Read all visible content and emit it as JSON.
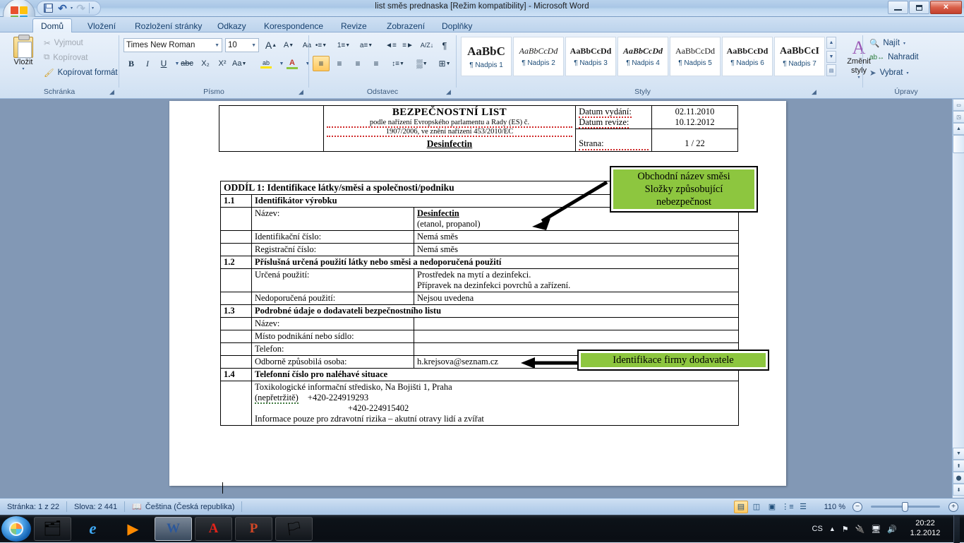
{
  "window": {
    "title": "list směs prednaska [Režim kompatibility] - Microsoft Word",
    "minimize": "minimize-button",
    "restore": "restore-button",
    "close": "✕"
  },
  "quick_access": {
    "save": "save-icon",
    "undo": "↶",
    "undo_dd": "▾",
    "redo": "↷",
    "customize": "▾"
  },
  "office_button": "office-logo",
  "ribbon": {
    "tabs": [
      {
        "label": "Domů",
        "active": true
      },
      {
        "label": "Vložení",
        "active": false
      },
      {
        "label": "Rozložení stránky",
        "active": false
      },
      {
        "label": "Odkazy",
        "active": false
      },
      {
        "label": "Korespondence",
        "active": false
      },
      {
        "label": "Revize",
        "active": false
      },
      {
        "label": "Zobrazení",
        "active": false
      },
      {
        "label": "Doplňky",
        "active": false
      }
    ],
    "clipboard": {
      "group_label": "Schránka",
      "paste": "Vložit",
      "paste_arrow": "▾",
      "cut": "Vyjmout",
      "copy": "Kopírovat",
      "format_painter": "Kopírovat formát"
    },
    "font": {
      "group_label": "Písmo",
      "font_name": "Times New Roman",
      "font_size": "10",
      "grow_font": "A",
      "shrink_font": "A",
      "clear_formatting": "Aa",
      "bold": "B",
      "italic": "I",
      "underline": "U",
      "strikethrough": "abc",
      "subscript": "X₂",
      "superscript": "X²",
      "change_case": "Aa",
      "highlight": "ab",
      "font_color": "A"
    },
    "paragraph": {
      "group_label": "Odstavec",
      "bullets": "•≡",
      "numbering": "1≡",
      "multilevel": "a≡",
      "decrease_indent": "◄≡",
      "increase_indent": "≡►",
      "sort": "A/Z↓",
      "show_marks": "¶",
      "align_left": "≡",
      "align_center": "≡",
      "align_right": "≡",
      "justify": "≡",
      "line_spacing": "↕≡",
      "shading": "▒",
      "borders": "⊞"
    },
    "styles": {
      "group_label": "Styly",
      "items": [
        {
          "sample": "AaBbC",
          "name": "¶ Nadpis 1",
          "weight": "bold",
          "style": "normal",
          "size": "17px"
        },
        {
          "sample": "AaBbCcDd",
          "name": "¶ Nadpis 2",
          "weight": "normal",
          "style": "italic",
          "size": "12px"
        },
        {
          "sample": "AaBbCcDd",
          "name": "¶ Nadpis 3",
          "weight": "bold",
          "style": "normal",
          "size": "12px"
        },
        {
          "sample": "AaBbCcDd",
          "name": "¶ Nadpis 4",
          "weight": "bold",
          "style": "italic",
          "size": "12px"
        },
        {
          "sample": "AaBbCcDd",
          "name": "¶ Nadpis 5",
          "weight": "normal",
          "style": "normal",
          "size": "12px"
        },
        {
          "sample": "AaBbCcDd",
          "name": "¶ Nadpis 6",
          "weight": "bold",
          "style": "normal",
          "size": "12px"
        },
        {
          "sample": "AaBbCcI",
          "name": "¶ Nadpis 7",
          "weight": "bold",
          "style": "normal",
          "size": "14px"
        }
      ],
      "change_styles": "Změnit styly",
      "change_styles_arrow": "▾"
    },
    "editing": {
      "group_label": "Úpravy",
      "find": "Najít",
      "find_arrow": "▾",
      "replace": "Nahradit",
      "select": "Vybrat",
      "select_arrow": "▾"
    }
  },
  "document": {
    "header": {
      "title": "BEZPEČNOSTNÍ LIST",
      "subtitle_line1": "podle nařízení Evropského parlamentu a Rady (ES) č.",
      "subtitle_line2": "1907/2006, ve znění nařízení 453/2010/EC",
      "product": "Desinfectin",
      "issue_label": "Datum vydání:",
      "issue_value": "02.11.2010",
      "revision_label": "Datum revize:",
      "revision_value": "10.12.2012",
      "page_label": "Strana:",
      "page_value": "1 / 22"
    },
    "section_title": "ODDÍL 1:  Identifikace  látky/směsi  a společnosti/podniku",
    "rows": [
      {
        "num": "1.1",
        "heading": "Identifikátor výrobku"
      },
      {
        "num": "",
        "label": "Název:",
        "value_bold": "Desinfectin",
        "value_sub": "(etanol, propanol)"
      },
      {
        "num": "",
        "label": "Identifikační číslo:",
        "value": "Nemá směs"
      },
      {
        "num": "",
        "label": "Registrační číslo:",
        "value": "Nemá směs"
      },
      {
        "num": "1.2",
        "heading": "Příslušná určená použití látky nebo směsi a nedoporučená použití"
      },
      {
        "num": "",
        "label": "Určená použití:",
        "value": "Prostředek na mytí a dezinfekci.",
        "value2": "Přípravek na dezinfekci povrchů a zařízení."
      },
      {
        "num": "",
        "label": "Nedoporučená použití:",
        "value": "Nejsou uvedena"
      },
      {
        "num": "1.3",
        "heading": "Podrobné údaje o dodavateli bezpečnostního listu"
      },
      {
        "num": "",
        "label": "Název:",
        "value": ""
      },
      {
        "num": "",
        "label": "Místo podnikání nebo sídlo:",
        "value": ""
      },
      {
        "num": "",
        "label": "Telefon:",
        "value": ""
      },
      {
        "num": "",
        "label": "Odborně způsobilá osoba:",
        "value": "h.krejsova@seznam.cz"
      },
      {
        "num": "1.4",
        "heading": "Telefonní číslo pro naléhavé situace"
      }
    ],
    "emergency": {
      "line1": "Toxikologické informační středisko, Na Bojišti 1, Praha",
      "line2_a": "(nepřetržitě)",
      "line2_b": "+420-224919293",
      "line3": "+420-224915402",
      "line4": "Informace pouze pro zdravotní rizika – akutní otravy lidí a zvířat"
    },
    "callouts": [
      {
        "line1": "Obchodní název směsi",
        "line2": "Složky způsobující",
        "line3": "nebezpečnost"
      },
      {
        "line1": "Identifikace firmy dodavatele"
      }
    ],
    "callout_color": "#8dc63f"
  },
  "status_bar": {
    "page": "Stránka: 1 z 22",
    "words": "Slova: 2 441",
    "proofing_icon": "spellcheck-icon",
    "language": "Čeština (Česká republika)",
    "views": [
      "print-layout-icon",
      "full-screen-reading-icon",
      "web-layout-icon",
      "outline-icon",
      "draft-icon"
    ],
    "zoom": "110 %",
    "zoom_out": "−",
    "zoom_in": "+"
  },
  "taskbar": {
    "start": "start-orb",
    "items": [
      "explorer-icon",
      "internet-explorer-icon",
      "media-player-icon",
      "word-icon",
      "acrobat-icon",
      "powerpoint-icon",
      "flags-icon"
    ],
    "tray": {
      "language": "CS",
      "show_hidden": "▲",
      "network_icon": "network-icon",
      "power_icon": "power-icon",
      "monitor_icon": "monitor-icon",
      "volume_icon": "volume-icon",
      "time": "20:22",
      "date": "1.2.2012"
    }
  }
}
